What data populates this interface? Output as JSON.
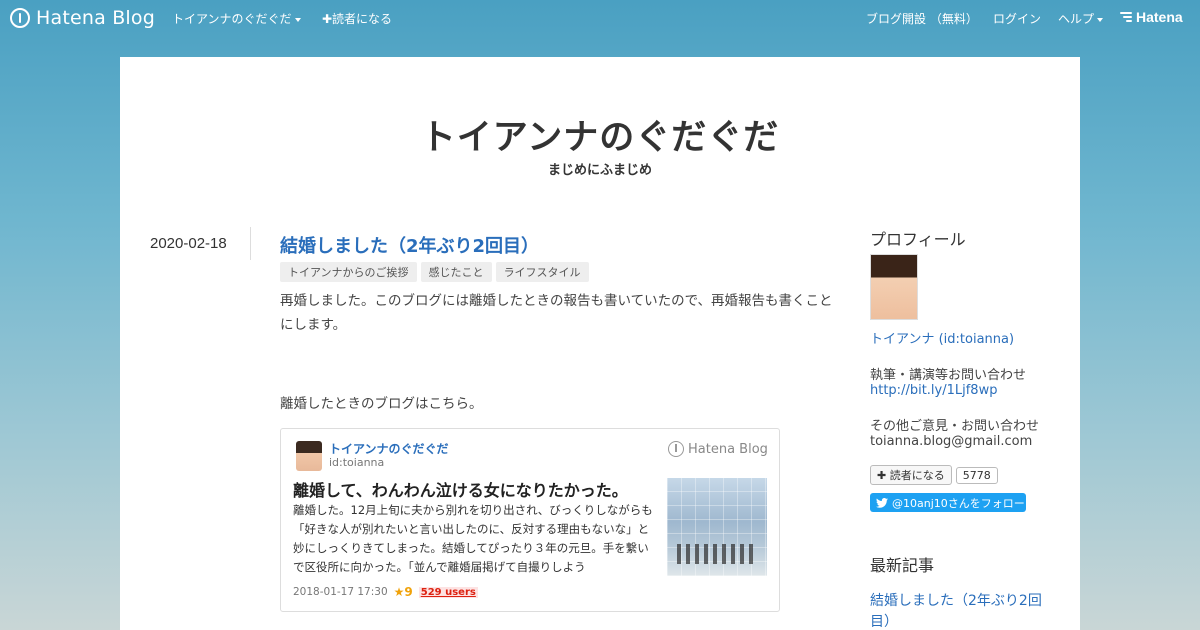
{
  "topbar": {
    "logo_text": "Hatena Blog",
    "blog_menu": "トイアンナのぐだぐだ",
    "reader_link": "✚読者になる",
    "open_blog": "ブログ開設 （無料）",
    "login": "ログイン",
    "help": "ヘルプ",
    "hatena": "Hatena"
  },
  "blog": {
    "title": "トイアンナのぐだぐだ",
    "subtitle": "まじめにふまじめ"
  },
  "entry": {
    "date": "2020-02-18",
    "title": "結婚しました（2年ぶり2回目）",
    "categories": [
      "トイアンナからのご挨拶",
      "感じたこと",
      "ライフスタイル"
    ],
    "para1": "再婚しました。このブログには離婚したときの報告も書いていたので、再婚報告も書くことにします。",
    "para2": "離婚したときのブログはこちら。"
  },
  "embed": {
    "blog_name": "トイアンナのぐだぐだ",
    "user_id": "id:toianna",
    "brand": "Hatena Blog",
    "title": "離婚して、わんわん泣ける女になりたかった。",
    "excerpt": "離婚した。12月上旬に夫から別れを切り出され、びっくりしながらも「好きな人が別れたいと言い出したのに、反対する理由もないな」と妙にしっくりきてしまった。結婚してぴったり３年の元旦。手を繋いで区役所に向かった。「並んで離婚届掲げて自撮りしよう",
    "date": "2018-01-17 17:30",
    "stars": "★9",
    "users": "529 users"
  },
  "sidebar": {
    "profile_heading": "プロフィール",
    "profile_name": "トイアンナ (id:toianna)",
    "contact1_label": "執筆・講演等お問い合わせ",
    "contact1_link": "http://bit.ly/1Ljf8wp",
    "contact2_label": "その他ご意見・お問い合わせ",
    "contact2_email": "toianna.blog@gmail.com",
    "reader_button": "読者になる",
    "reader_count": "5778",
    "twitter_follow": "@10anj10さんをフォロー",
    "recent_heading": "最新記事",
    "recent_items": [
      "結婚しました（2年ぶり2回目）"
    ]
  },
  "colors": {
    "link": "#2a6ebb",
    "twitter": "#1da1f2",
    "star": "#f0a20a",
    "users": "#dd1111"
  }
}
